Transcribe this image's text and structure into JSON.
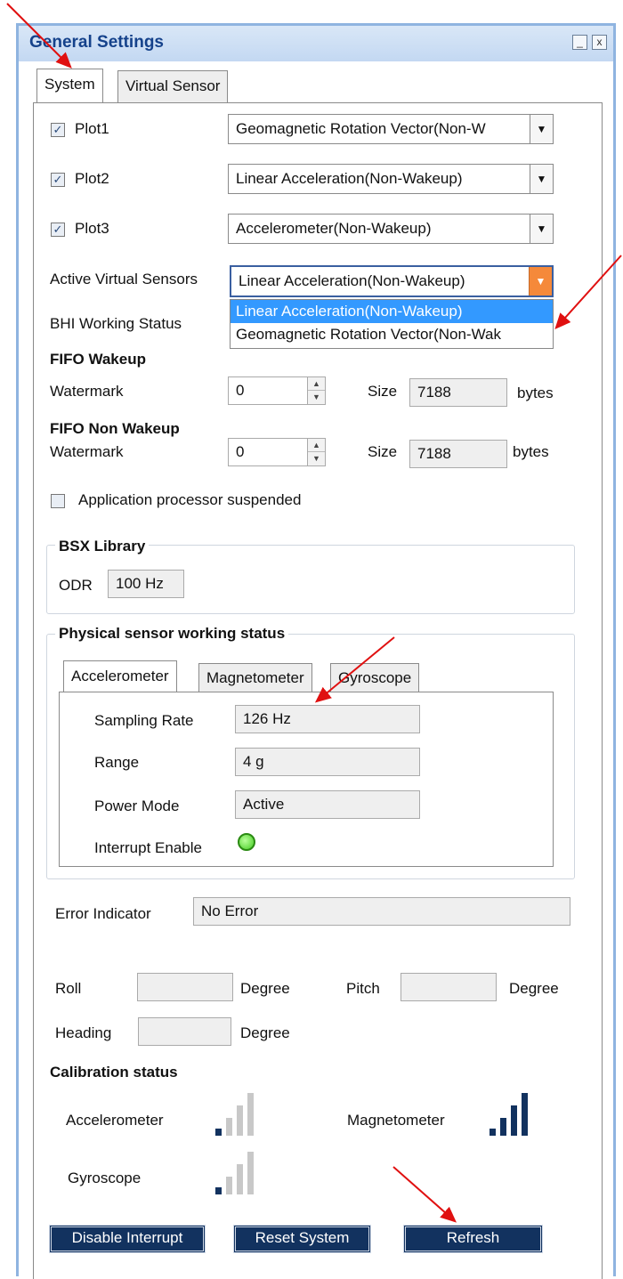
{
  "window": {
    "title": "General Settings",
    "minimize_glyph": "_",
    "close_glyph": "x",
    "tabs": [
      "System",
      "Virtual Sensor"
    ]
  },
  "plots": [
    {
      "label": "Plot1",
      "checked": true,
      "value": "Geomagnetic Rotation Vector(Non-W"
    },
    {
      "label": "Plot2",
      "checked": true,
      "value": "Linear Acceleration(Non-Wakeup)"
    },
    {
      "label": "Plot3",
      "checked": true,
      "value": "Accelerometer(Non-Wakeup)"
    }
  ],
  "active_virtual_sensors": {
    "label": "Active Virtual Sensors",
    "value": "Linear Acceleration(Non-Wakeup)",
    "options": [
      "Linear Acceleration(Non-Wakeup)",
      "Geomagnetic Rotation Vector(Non-Wak"
    ]
  },
  "bhi_status_label": "BHI Working Status",
  "fifo_wakeup": {
    "heading": "FIFO Wakeup",
    "watermark_label": "Watermark",
    "watermark": "0",
    "size_label": "Size",
    "size": "7188",
    "unit": "bytes"
  },
  "fifo_non_wakeup": {
    "heading": "FIFO Non Wakeup",
    "watermark_label": "Watermark",
    "watermark": "0",
    "size_label": "Size",
    "size": "7188",
    "unit": "bytes"
  },
  "app_suspended": {
    "label": "Application processor suspended",
    "checked": false
  },
  "bsx": {
    "title": "BSX Library",
    "odr_label": "ODR",
    "odr": "100 Hz"
  },
  "physical": {
    "title": "Physical sensor working status",
    "tabs": [
      "Accelerometer",
      "Magnetometer",
      "Gyroscope"
    ],
    "sampling_rate_label": "Sampling Rate",
    "sampling_rate": "126 Hz",
    "range_label": "Range",
    "range": "4 g",
    "power_mode_label": "Power Mode",
    "power_mode": "Active",
    "interrupt_label": "Interrupt Enable",
    "interrupt_color": "#44cc22"
  },
  "error": {
    "label": "Error Indicator",
    "value": "No Error"
  },
  "orientation": {
    "heading": "",
    "roll_label": "Roll",
    "pitch_label": "Pitch",
    "heading_label": "Heading",
    "unit": "Degree",
    "roll": "",
    "pitch": ""
  },
  "calibration": {
    "heading": "Calibration status",
    "accelerometer_label": "Accelerometer",
    "accelerometer_level": 1,
    "magnetometer_label": "Magnetometer",
    "magnetometer_level": 4,
    "gyroscope_label": "Gyroscope",
    "gyroscope_level": 1
  },
  "buttons": {
    "disable_interrupt": "Disable Interrupt",
    "reset_system": "Reset System",
    "refresh": "Refresh"
  },
  "colors": {
    "accent": "#12325f",
    "annotation_arrow": "#e01010",
    "dropdown_selected": "#3399ff"
  }
}
